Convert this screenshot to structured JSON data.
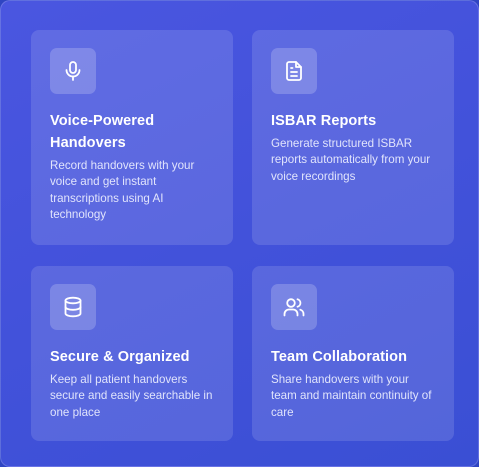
{
  "features": [
    {
      "title": "Voice-Powered Handovers",
      "description": "Record handovers with your voice and get instant transcriptions using AI technology",
      "icon": "microphone-icon"
    },
    {
      "title": "ISBAR Reports",
      "description": "Generate structured ISBAR reports automatically from your voice recordings",
      "icon": "document-icon"
    },
    {
      "title": "Secure & Organized",
      "description": "Keep all patient handovers secure and easily searchable in one place",
      "icon": "database-icon"
    },
    {
      "title": "Team Collaboration",
      "description": "Share handovers with your team and maintain continuity of care",
      "icon": "users-icon"
    }
  ],
  "colors": {
    "background": "#2f45c2",
    "panel": "#4352db",
    "text": "#ffffff"
  }
}
